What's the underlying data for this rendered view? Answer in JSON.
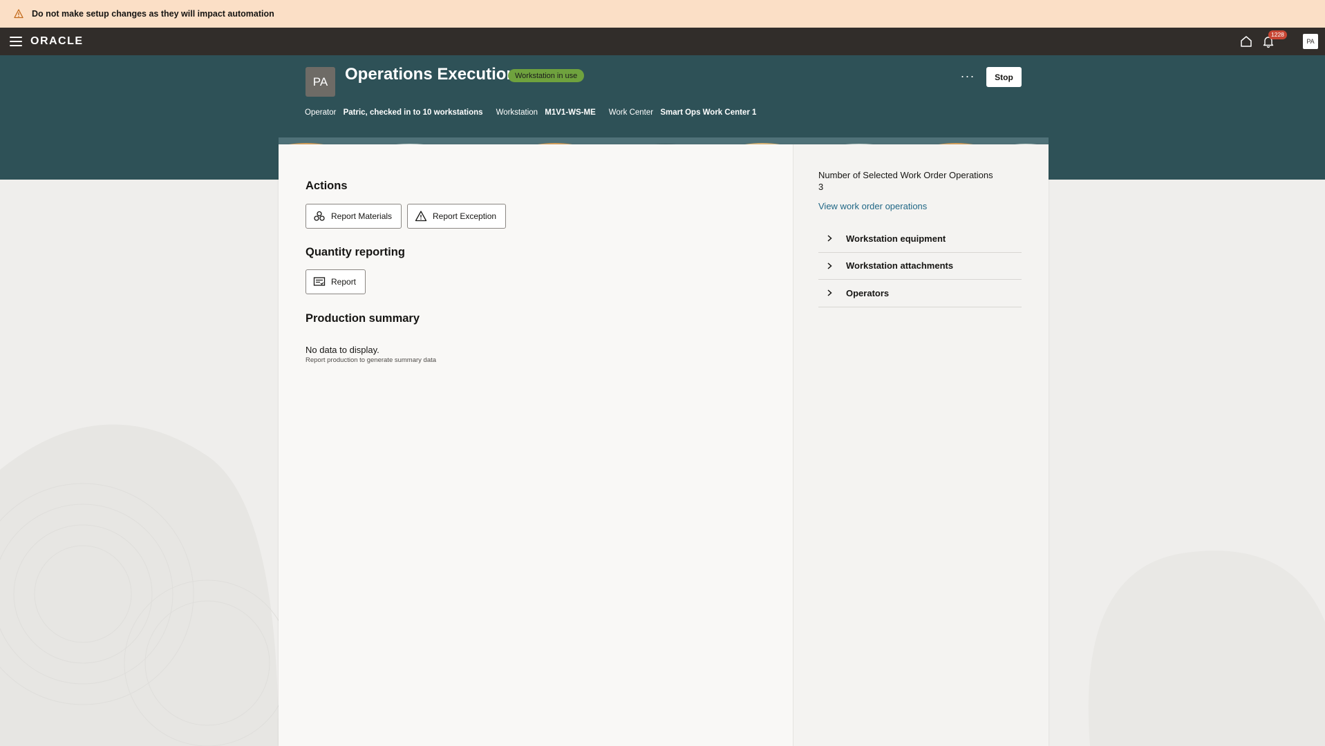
{
  "banner": {
    "message": "Do not make setup changes as they will impact automation"
  },
  "topbar": {
    "logo": "ORACLE",
    "notification_count": "1228",
    "user_initials": "PA"
  },
  "header": {
    "avatar_initials": "PA",
    "title": "Operations Execution",
    "status_badge": "Workstation in use",
    "more_label": "···",
    "stop_label": "Stop",
    "operator_label": "Operator",
    "operator_value": "Patric, checked in to 10 workstations",
    "workstation_label": "Workstation",
    "workstation_value": "M1V1-WS-ME",
    "workcenter_label": "Work Center",
    "workcenter_value": "Smart Ops Work Center 1"
  },
  "actions": {
    "heading": "Actions",
    "report_materials": "Report Materials",
    "report_exception": "Report Exception"
  },
  "quantity": {
    "heading": "Quantity reporting",
    "report": "Report"
  },
  "production": {
    "heading": "Production summary",
    "no_data": "No data to display.",
    "no_data_hint": "Report production to generate summary data"
  },
  "sidepanel": {
    "count_label": "Number of Selected Work Order Operations",
    "count_value": "3",
    "link": "View work order operations",
    "accordion": [
      {
        "label": "Workstation equipment"
      },
      {
        "label": "Workstation attachments"
      },
      {
        "label": "Operators"
      }
    ]
  },
  "colors": {
    "banner_bg": "#fbdfc6",
    "topbar_bg": "#312d2a",
    "header_bg": "#2e5157",
    "status_green": "#6fa23e",
    "link_blue": "#1f6685",
    "badge_red": "#c74634"
  }
}
